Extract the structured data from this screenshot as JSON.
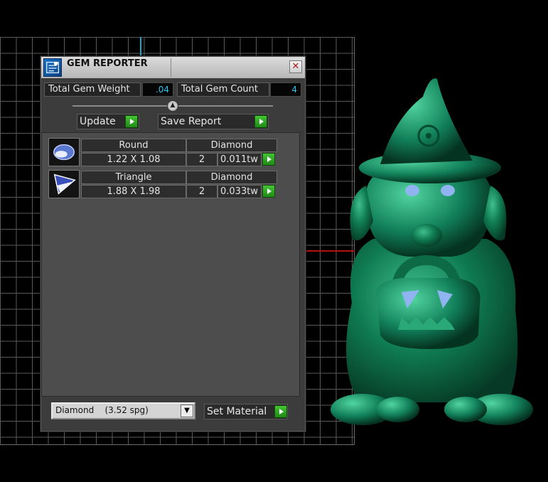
{
  "window": {
    "title": "GEM REPORTER",
    "close_glyph": "✕"
  },
  "summary": {
    "weight_label": "Total Gem Weight",
    "weight_value": ".04",
    "count_label": "Total Gem Count",
    "count_value": "4"
  },
  "toolbar": {
    "update_label": "Update",
    "save_label": "Save Report",
    "slider_glyph": "▲"
  },
  "gems": [
    {
      "icon": "round-gem-icon",
      "shape": "Round",
      "material": "Diamond",
      "size": "1.22 X 1.08",
      "count": "2",
      "weight": "0.011tw"
    },
    {
      "icon": "triangle-gem-icon",
      "shape": "Triangle",
      "material": "Diamond",
      "size": "1.88 X 1.98",
      "count": "2",
      "weight": "0.033tw"
    }
  ],
  "material_select": {
    "value": "Diamond    (3.52 spg)",
    "arrow_glyph": "▼"
  },
  "set_material_label": "Set Material",
  "colors": {
    "accent_value": "#2cc6ee",
    "play_button": "#2fa824",
    "figure": "#0f7a52",
    "axis_x": "#b01212",
    "axis_y": "#1aa8c8"
  }
}
